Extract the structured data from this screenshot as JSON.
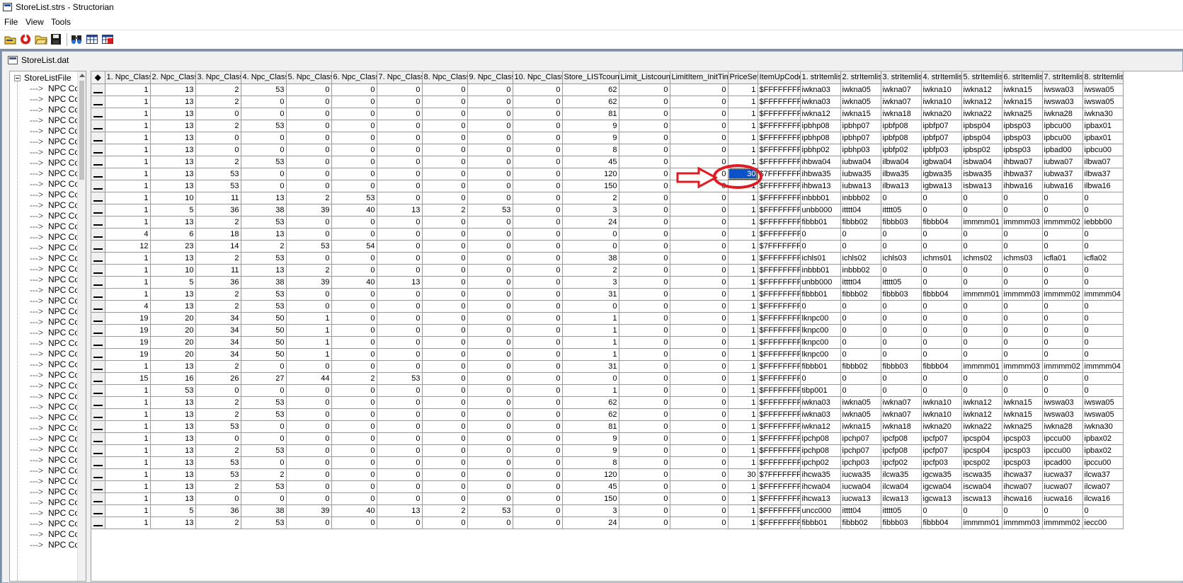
{
  "window": {
    "title": "StoreList.strs - Structorian"
  },
  "menu": [
    {
      "label": "File"
    },
    {
      "label": "View"
    },
    {
      "label": "Tools"
    }
  ],
  "toolbar": {
    "buttons": [
      {
        "icon": "open-structure-icon"
      },
      {
        "icon": "reload-icon"
      },
      {
        "icon": "open-folder-icon"
      },
      {
        "icon": "save-icon"
      },
      {
        "icon": "find-icon"
      },
      {
        "icon": "table-view-icon"
      },
      {
        "icon": "grid-edit-icon"
      }
    ]
  },
  "document": {
    "title": "StoreList.dat"
  },
  "tree": {
    "root": "StoreListFile",
    "branch_prefix": "--->",
    "item_label": "NPC Co",
    "item_count": 44
  },
  "grid": {
    "corner": "◆",
    "columns": [
      "1. Npc_Class",
      "2. Npc_Class",
      "3. Npc_Class",
      "4. Npc_Class",
      "5. Npc_Class",
      "6. Npc_Class",
      "7. Npc_Class",
      "8. Npc_Class",
      "9. Npc_Class",
      "10. Npc_Class",
      "Store_LISTcount",
      "Limit_Listcount",
      "LimitItem_InitTime",
      "PriceSet",
      "ItemUpCode",
      "1. strItemlist",
      "2. strItemlist",
      "3. strItemlist",
      "4. strItemlist",
      "5. strItemlist",
      "6. strItemlist",
      "7. strItemlist",
      "8. strItemlist"
    ],
    "selected": {
      "row": 7,
      "col": 13
    },
    "rows": [
      [
        "1",
        "13",
        "2",
        "53",
        "0",
        "0",
        "0",
        "0",
        "0",
        "0",
        "62",
        "0",
        "0",
        "1",
        "$FFFFFFFF",
        "iwkna03",
        "iwkna05",
        "iwkna07",
        "iwkna10",
        "iwkna12",
        "iwkna15",
        "iwswa03",
        "iwswa05"
      ],
      [
        "1",
        "13",
        "2",
        "0",
        "0",
        "0",
        "0",
        "0",
        "0",
        "0",
        "62",
        "0",
        "0",
        "1",
        "$FFFFFFFF",
        "iwkna03",
        "iwkna05",
        "iwkna07",
        "iwkna10",
        "iwkna12",
        "iwkna15",
        "iwswa03",
        "iwswa05"
      ],
      [
        "1",
        "13",
        "0",
        "0",
        "0",
        "0",
        "0",
        "0",
        "0",
        "0",
        "81",
        "0",
        "0",
        "1",
        "$FFFFFFFF",
        "iwkna12",
        "iwkna15",
        "iwkna18",
        "iwkna20",
        "iwkna22",
        "iwkna25",
        "iwkna28",
        "iwkna30"
      ],
      [
        "1",
        "13",
        "2",
        "53",
        "0",
        "0",
        "0",
        "0",
        "0",
        "0",
        "9",
        "0",
        "0",
        "1",
        "$FFFFFFFF",
        "ipbhp08",
        "ipbhp07",
        "ipbfp08",
        "ipbfp07",
        "ipbsp04",
        "ipbsp03",
        "ipbcu00",
        "ipbax01"
      ],
      [
        "1",
        "13",
        "0",
        "0",
        "0",
        "0",
        "0",
        "0",
        "0",
        "0",
        "9",
        "0",
        "0",
        "1",
        "$FFFFFFFF",
        "ipbhp08",
        "ipbhp07",
        "ipbfp08",
        "ipbfp07",
        "ipbsp04",
        "ipbsp03",
        "ipbcu00",
        "ipbax01"
      ],
      [
        "1",
        "13",
        "0",
        "0",
        "0",
        "0",
        "0",
        "0",
        "0",
        "0",
        "8",
        "0",
        "0",
        "1",
        "$FFFFFFFF",
        "ipbhp02",
        "ipbhp03",
        "ipbfp02",
        "ipbfp03",
        "ipbsp02",
        "ipbsp03",
        "ipbad00",
        "ipbcu00"
      ],
      [
        "1",
        "13",
        "2",
        "53",
        "0",
        "0",
        "0",
        "0",
        "0",
        "0",
        "45",
        "0",
        "0",
        "1",
        "$FFFFFFFF",
        "ihbwa04",
        "iubwa04",
        "ilbwa04",
        "igbwa04",
        "isbwa04",
        "ihbwa07",
        "iubwa07",
        "ilbwa07"
      ],
      [
        "1",
        "13",
        "53",
        "0",
        "0",
        "0",
        "0",
        "0",
        "0",
        "0",
        "120",
        "0",
        "0",
        "30",
        "$7FFFFFFF",
        "ihbwa35",
        "iubwa35",
        "ilbwa35",
        "igbwa35",
        "isbwa35",
        "ihbwa37",
        "iubwa37",
        "ilbwa37"
      ],
      [
        "1",
        "13",
        "53",
        "0",
        "0",
        "0",
        "0",
        "0",
        "0",
        "0",
        "150",
        "0",
        "0",
        "1",
        "$FFFFFFFF",
        "ihbwa13",
        "iubwa13",
        "ilbwa13",
        "igbwa13",
        "isbwa13",
        "ihbwa16",
        "iubwa16",
        "ilbwa16"
      ],
      [
        "1",
        "10",
        "11",
        "13",
        "2",
        "53",
        "0",
        "0",
        "0",
        "0",
        "2",
        "0",
        "0",
        "1",
        "$FFFFFFFF",
        "inbbb01",
        "inbbb02",
        "0",
        "0",
        "0",
        "0",
        "0",
        "0"
      ],
      [
        "1",
        "5",
        "36",
        "38",
        "39",
        "40",
        "13",
        "2",
        "53",
        "0",
        "3",
        "0",
        "0",
        "1",
        "$FFFFFFFF",
        "unbb000",
        "itttt04",
        "itttt05",
        "0",
        "0",
        "0",
        "0",
        "0"
      ],
      [
        "1",
        "13",
        "2",
        "53",
        "0",
        "0",
        "0",
        "0",
        "0",
        "0",
        "24",
        "0",
        "0",
        "1",
        "$FFFFFFFF",
        "fibbb01",
        "fibbb02",
        "fibbb03",
        "fibbb04",
        "immmm01",
        "immmm03",
        "immmm02",
        "iebbb00"
      ],
      [
        "4",
        "6",
        "18",
        "13",
        "0",
        "0",
        "0",
        "0",
        "0",
        "0",
        "0",
        "0",
        "0",
        "1",
        "$FFFFFFFF",
        "0",
        "0",
        "0",
        "0",
        "0",
        "0",
        "0",
        "0"
      ],
      [
        "12",
        "23",
        "14",
        "2",
        "53",
        "54",
        "0",
        "0",
        "0",
        "0",
        "0",
        "0",
        "0",
        "1",
        "$7FFFFFFF",
        "0",
        "0",
        "0",
        "0",
        "0",
        "0",
        "0",
        "0"
      ],
      [
        "1",
        "13",
        "2",
        "53",
        "0",
        "0",
        "0",
        "0",
        "0",
        "0",
        "38",
        "0",
        "0",
        "1",
        "$FFFFFFFF",
        "ichls01",
        "ichls02",
        "ichls03",
        "ichms01",
        "ichms02",
        "ichms03",
        "icfla01",
        "icfla02"
      ],
      [
        "1",
        "10",
        "11",
        "13",
        "2",
        "0",
        "0",
        "0",
        "0",
        "0",
        "2",
        "0",
        "0",
        "1",
        "$FFFFFFFF",
        "inbbb01",
        "inbbb02",
        "0",
        "0",
        "0",
        "0",
        "0",
        "0"
      ],
      [
        "1",
        "5",
        "36",
        "38",
        "39",
        "40",
        "13",
        "0",
        "0",
        "0",
        "3",
        "0",
        "0",
        "1",
        "$FFFFFFFF",
        "unbb000",
        "itttt04",
        "itttt05",
        "0",
        "0",
        "0",
        "0",
        "0"
      ],
      [
        "1",
        "13",
        "2",
        "53",
        "0",
        "0",
        "0",
        "0",
        "0",
        "0",
        "31",
        "0",
        "0",
        "1",
        "$FFFFFFFF",
        "fibbb01",
        "fibbb02",
        "fibbb03",
        "fibbb04",
        "immmm01",
        "immmm03",
        "immmm02",
        "immmm04"
      ],
      [
        "4",
        "13",
        "2",
        "53",
        "0",
        "0",
        "0",
        "0",
        "0",
        "0",
        "0",
        "0",
        "0",
        "1",
        "$FFFFFFFF",
        "0",
        "0",
        "0",
        "0",
        "0",
        "0",
        "0",
        "0"
      ],
      [
        "19",
        "20",
        "34",
        "50",
        "1",
        "0",
        "0",
        "0",
        "0",
        "0",
        "1",
        "0",
        "0",
        "1",
        "$FFFFFFFF",
        "lknpc00",
        "0",
        "0",
        "0",
        "0",
        "0",
        "0",
        "0"
      ],
      [
        "19",
        "20",
        "34",
        "50",
        "1",
        "0",
        "0",
        "0",
        "0",
        "0",
        "1",
        "0",
        "0",
        "1",
        "$FFFFFFFF",
        "lknpc00",
        "0",
        "0",
        "0",
        "0",
        "0",
        "0",
        "0"
      ],
      [
        "19",
        "20",
        "34",
        "50",
        "1",
        "0",
        "0",
        "0",
        "0",
        "0",
        "1",
        "0",
        "0",
        "1",
        "$FFFFFFFF",
        "lknpc00",
        "0",
        "0",
        "0",
        "0",
        "0",
        "0",
        "0"
      ],
      [
        "19",
        "20",
        "34",
        "50",
        "1",
        "0",
        "0",
        "0",
        "0",
        "0",
        "1",
        "0",
        "0",
        "1",
        "$FFFFFFFF",
        "lknpc00",
        "0",
        "0",
        "0",
        "0",
        "0",
        "0",
        "0"
      ],
      [
        "1",
        "13",
        "2",
        "0",
        "0",
        "0",
        "0",
        "0",
        "0",
        "0",
        "31",
        "0",
        "0",
        "1",
        "$FFFFFFFF",
        "fibbb01",
        "fibbb02",
        "fibbb03",
        "fibbb04",
        "immmm01",
        "immmm03",
        "immmm02",
        "immmm04"
      ],
      [
        "15",
        "16",
        "26",
        "27",
        "44",
        "2",
        "53",
        "0",
        "0",
        "0",
        "0",
        "0",
        "0",
        "1",
        "$FFFFFFFF",
        "0",
        "0",
        "0",
        "0",
        "0",
        "0",
        "0",
        "0"
      ],
      [
        "1",
        "53",
        "0",
        "0",
        "0",
        "0",
        "0",
        "0",
        "0",
        "0",
        "1",
        "0",
        "0",
        "1",
        "$FFFFFFFF",
        "tibp001",
        "0",
        "0",
        "0",
        "0",
        "0",
        "0",
        "0"
      ],
      [
        "1",
        "13",
        "2",
        "53",
        "0",
        "0",
        "0",
        "0",
        "0",
        "0",
        "62",
        "0",
        "0",
        "1",
        "$FFFFFFFF",
        "iwkna03",
        "iwkna05",
        "iwkna07",
        "iwkna10",
        "iwkna12",
        "iwkna15",
        "iwswa03",
        "iwswa05"
      ],
      [
        "1",
        "13",
        "2",
        "53",
        "0",
        "0",
        "0",
        "0",
        "0",
        "0",
        "62",
        "0",
        "0",
        "1",
        "$FFFFFFFF",
        "iwkna03",
        "iwkna05",
        "iwkna07",
        "iwkna10",
        "iwkna12",
        "iwkna15",
        "iwswa03",
        "iwswa05"
      ],
      [
        "1",
        "13",
        "53",
        "0",
        "0",
        "0",
        "0",
        "0",
        "0",
        "0",
        "81",
        "0",
        "0",
        "1",
        "$FFFFFFFF",
        "iwkna12",
        "iwkna15",
        "iwkna18",
        "iwkna20",
        "iwkna22",
        "iwkna25",
        "iwkna28",
        "iwkna30"
      ],
      [
        "1",
        "13",
        "0",
        "0",
        "0",
        "0",
        "0",
        "0",
        "0",
        "0",
        "9",
        "0",
        "0",
        "1",
        "$FFFFFFFF",
        "ipchp08",
        "ipchp07",
        "ipcfp08",
        "ipcfp07",
        "ipcsp04",
        "ipcsp03",
        "ipccu00",
        "ipbax02"
      ],
      [
        "1",
        "13",
        "2",
        "53",
        "0",
        "0",
        "0",
        "0",
        "0",
        "0",
        "9",
        "0",
        "0",
        "1",
        "$FFFFFFFF",
        "ipchp08",
        "ipchp07",
        "ipcfp08",
        "ipcfp07",
        "ipcsp04",
        "ipcsp03",
        "ipccu00",
        "ipbax02"
      ],
      [
        "1",
        "13",
        "53",
        "0",
        "0",
        "0",
        "0",
        "0",
        "0",
        "0",
        "8",
        "0",
        "0",
        "1",
        "$FFFFFFFF",
        "ipchp02",
        "ipchp03",
        "ipcfp02",
        "ipcfp03",
        "ipcsp02",
        "ipcsp03",
        "ipcad00",
        "ipccu00"
      ],
      [
        "1",
        "13",
        "53",
        "2",
        "0",
        "0",
        "0",
        "0",
        "0",
        "0",
        "120",
        "0",
        "0",
        "30",
        "$7FFFFFFF",
        "ihcwa35",
        "iucwa35",
        "ilcwa35",
        "igcwa35",
        "iscwa35",
        "ihcwa37",
        "iucwa37",
        "ilcwa37"
      ],
      [
        "1",
        "13",
        "2",
        "53",
        "0",
        "0",
        "0",
        "0",
        "0",
        "0",
        "45",
        "0",
        "0",
        "1",
        "$FFFFFFFF",
        "ihcwa04",
        "iucwa04",
        "ilcwa04",
        "igcwa04",
        "iscwa04",
        "ihcwa07",
        "iucwa07",
        "ilcwa07"
      ],
      [
        "1",
        "13",
        "0",
        "0",
        "0",
        "0",
        "0",
        "0",
        "0",
        "0",
        "150",
        "0",
        "0",
        "1",
        "$FFFFFFFF",
        "ihcwa13",
        "iucwa13",
        "ilcwa13",
        "igcwa13",
        "iscwa13",
        "ihcwa16",
        "iucwa16",
        "ilcwa16"
      ],
      [
        "1",
        "5",
        "36",
        "38",
        "39",
        "40",
        "13",
        "2",
        "53",
        "0",
        "3",
        "0",
        "0",
        "1",
        "$FFFFFFFF",
        "uncc000",
        "itttt04",
        "itttt05",
        "0",
        "0",
        "0",
        "0",
        "0"
      ],
      [
        "1",
        "13",
        "2",
        "53",
        "0",
        "0",
        "0",
        "0",
        "0",
        "0",
        "24",
        "0",
        "0",
        "1",
        "$FFFFFFFF",
        "fibbb01",
        "fibbb02",
        "fibbb03",
        "fibbb04",
        "immmm01",
        "immmm03",
        "immmm02",
        "iecc00"
      ]
    ]
  }
}
